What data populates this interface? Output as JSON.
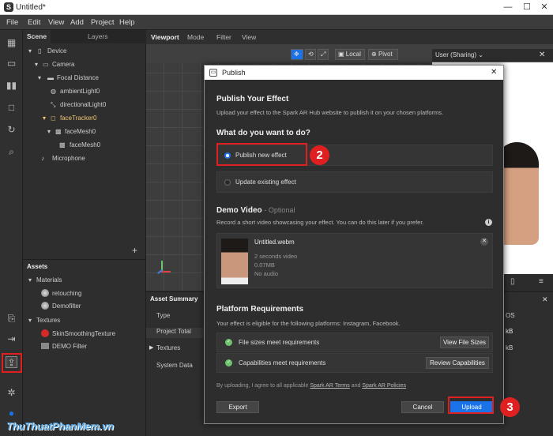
{
  "window": {
    "title": "Untitled*",
    "min": "—",
    "max": "☐",
    "close": "✕"
  },
  "menu": [
    "File",
    "Edit",
    "View",
    "Add",
    "Project",
    "Help"
  ],
  "scene_tabs": {
    "scene": "Scene",
    "layers": "Layers"
  },
  "tree": [
    "Device",
    "Camera",
    "Focal Distance",
    "ambientLight0",
    "directionalLight0",
    "faceTracker0",
    "faceMesh0",
    "faceMesh0",
    "Microphone"
  ],
  "plus": "+",
  "assets": {
    "header": "Assets",
    "materials": "Materials",
    "m1": "retouching",
    "m2": "Demofilter",
    "textures": "Textures",
    "t1": "SkinSmoothingTexture",
    "t2": "DEMO Filter"
  },
  "viewport": {
    "tab": "Viewport",
    "mode": "Mode",
    "filter": "Filter",
    "view": "View",
    "local": "Local",
    "pivot": "Pivot",
    "camera": "User (Sharing)"
  },
  "summary": {
    "title": "Asset Summary",
    "type": "Type",
    "total": "Project Total",
    "textures": "Textures",
    "sysdata": "System Data",
    "r1": "OS",
    "r2": "kB",
    "r3": "kB"
  },
  "dialog": {
    "title": "Publish",
    "close": "✕",
    "heading": "Publish Your Effect",
    "desc": "Upload your effect to the Spark AR Hub website to publish it on your chosen platforms.",
    "question": "What do you want to do?",
    "opt1": "Publish new effect",
    "opt2": "Update existing effect",
    "demo": "Demo Video",
    "optional": "- Optional",
    "demo_desc": "Record a short video showcasing your effect. You can do this later if you prefer.",
    "info": "i",
    "file": "Untitled.webm",
    "dur": "2 seconds video",
    "size": "0.07MB",
    "audio": "No audio",
    "platform": "Platform Requirements",
    "eligible": "Your effect is eligible for the following platforms: Instagram, Facebook.",
    "req1": "File sizes meet requirements",
    "req1btn": "View File Sizes",
    "req2": "Capabilities meet requirements",
    "req2btn": "Review Capabilities",
    "terms1": "By uploading, I agree to all applicable",
    "terms2": "Spark AR Terms",
    "and": "and",
    "terms3": "Spark AR Policies",
    "export": "Export",
    "cancel": "Cancel",
    "upload": "Upload"
  },
  "badges": [
    "1",
    "2",
    "3"
  ],
  "watermark": "ThuThuatPhanMem.vn",
  "colors": {
    "accent": "#1a73e8",
    "annotation": "#e02020",
    "selected": "#f0c674"
  }
}
